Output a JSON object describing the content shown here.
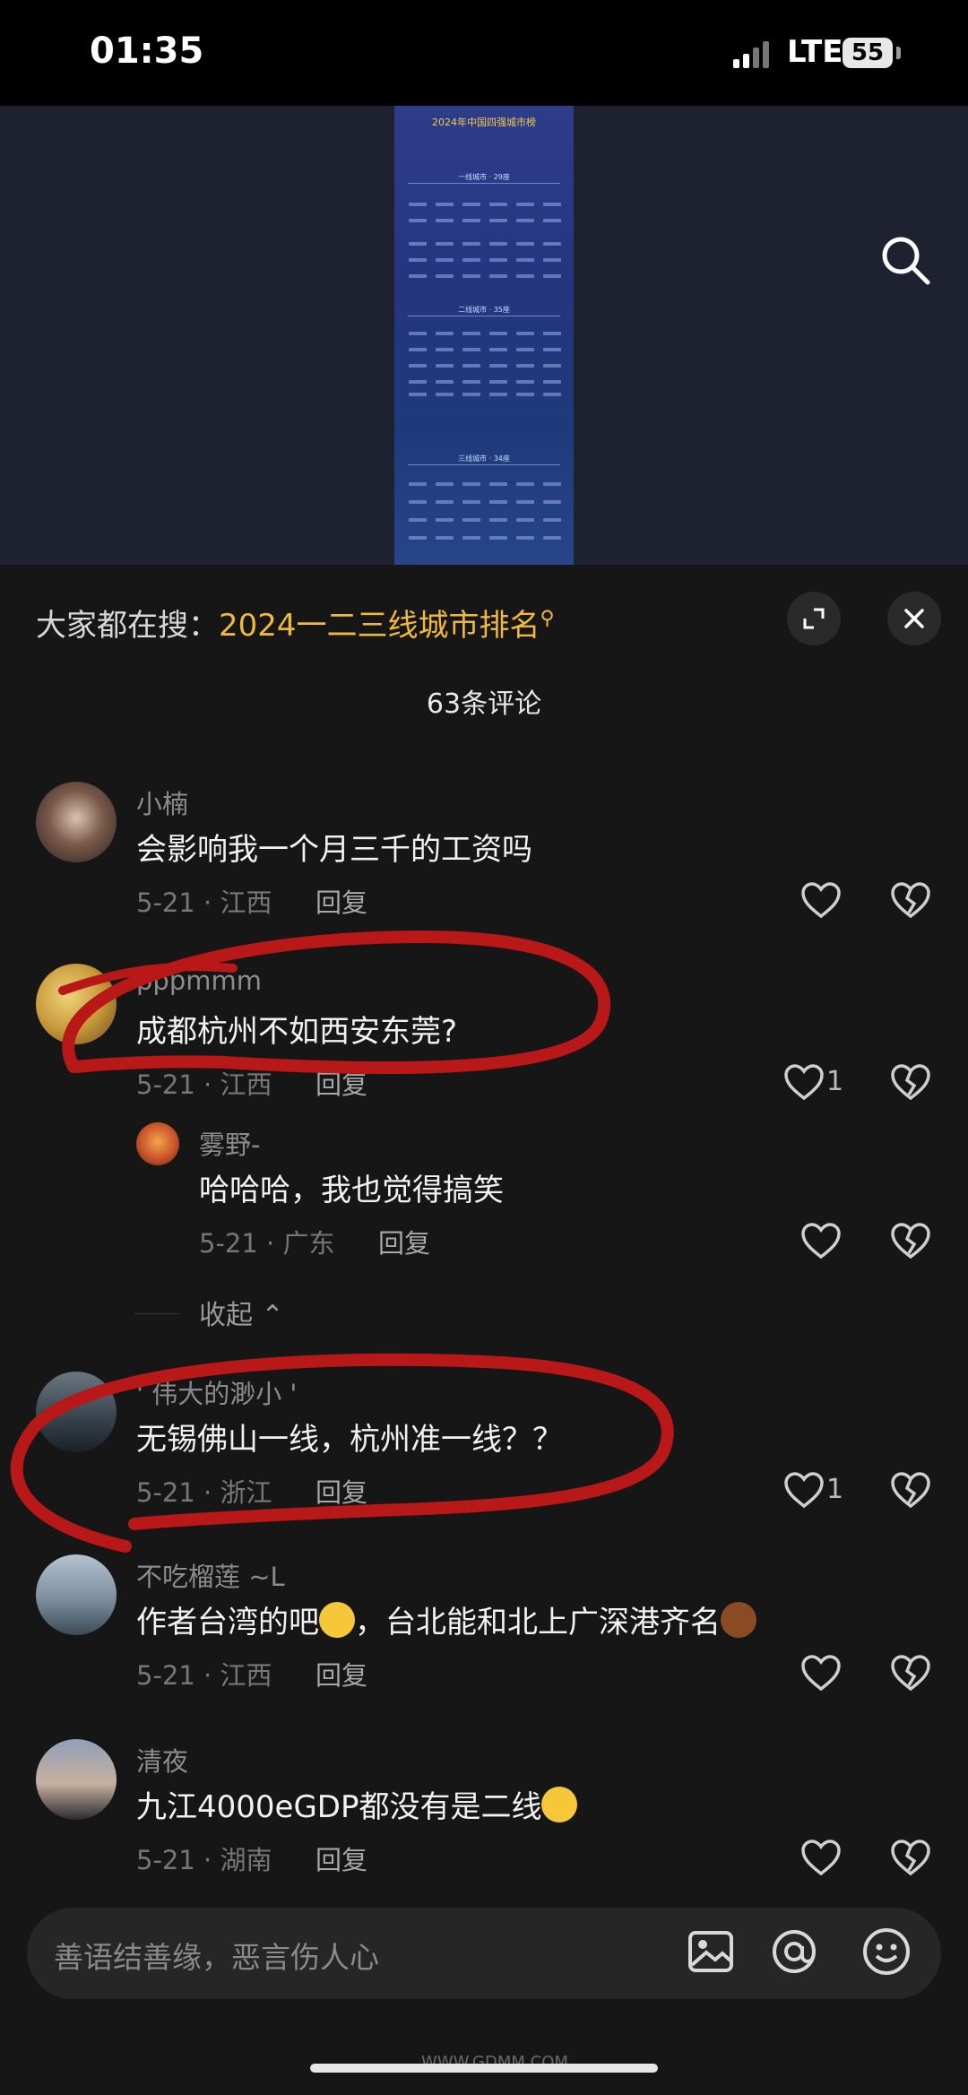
{
  "status_bar": {
    "time": "01:35",
    "network": "LTE",
    "battery": "55"
  },
  "media": {
    "poster_title": "2024年中国四强城市榜",
    "poster_heads": [
      "一线城市 · 29座",
      "二线城市 · 35座",
      "三线城市 · 34座"
    ]
  },
  "sheet": {
    "hot_search_prefix": "大家都在搜：",
    "hot_search_query": "2024一二三线城市排名",
    "comment_count": "63条评论"
  },
  "comments": [
    {
      "author": "小楠",
      "text": "会影响我一个月三千的工资吗",
      "date": "5-21 · 江西",
      "reply": "回复",
      "likes": ""
    },
    {
      "author": "pppmmm",
      "text": "成都杭州不如西安东莞?",
      "date": "5-21 · 江西",
      "reply": "回复",
      "likes": "1"
    },
    {
      "author": "雾野-",
      "text": "哈哈哈，我也觉得搞笑",
      "date": "5-21 · 广东",
      "reply": "回复",
      "likes": ""
    },
    {
      "author": "' 伟大的渺小 '",
      "text": "无锡佛山一线，杭州准一线？？",
      "date": "5-21 · 浙江",
      "reply": "回复",
      "likes": "1"
    },
    {
      "author": "不吃榴莲 ~L",
      "text_a": "作者台湾的吧",
      "text_b": "，台北能和北上广深港齐名",
      "date": "5-21 · 江西",
      "reply": "回复",
      "likes": ""
    },
    {
      "author": "清夜",
      "text": "九江4000eGDP都没有是二线",
      "date": "5-21 · 湖南",
      "reply": "回复",
      "likes": ""
    }
  ],
  "collapse_label": "收起",
  "input": {
    "placeholder": "善语结善缘，恶言伤人心"
  },
  "watermark": "WWW.GDMM.COM",
  "colors": {
    "accent": "#f0b93a",
    "annotation": "#b81818",
    "background": "#161616"
  }
}
